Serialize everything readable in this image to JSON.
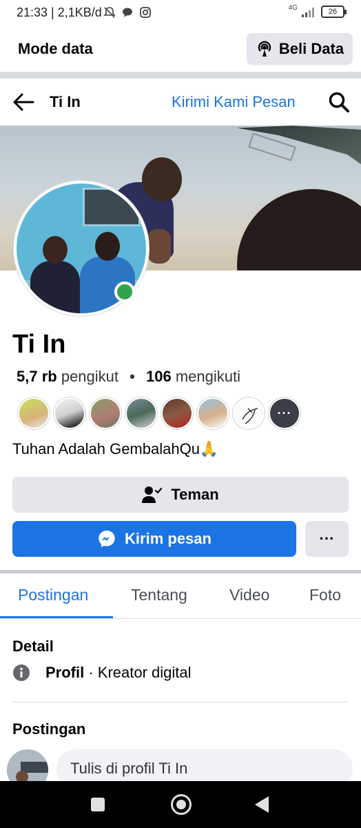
{
  "status_bar": {
    "time": "21:33",
    "network_speed": "2,1KB/d",
    "network_type": "4G",
    "battery": "26",
    "icons": [
      "bell-off-icon",
      "chat-bubble-icon",
      "instagram-icon",
      "signal-icon",
      "battery-icon"
    ]
  },
  "data_mode": {
    "title": "Mode data",
    "buy_button": "Beli Data",
    "buy_icon": "broadcast-icon"
  },
  "nav": {
    "title": "Ti In",
    "message_link": "Kirimi Kami Pesan",
    "icons": [
      "back-arrow-icon",
      "search-icon"
    ]
  },
  "profile": {
    "name": "Ti In",
    "followers_count": "5,7 rb",
    "followers_label": "pengikut",
    "following_count": "106",
    "following_label": "mengikuti",
    "separator": "•",
    "bio": "Tuhan Adalah GembalahQu🙏",
    "online": true,
    "friend_avatars_count": 8,
    "friend_more_label": "···"
  },
  "actions": {
    "friend_button": "Teman",
    "message_button": "Kirim pesan",
    "more_button": "···",
    "accent_color": "#1b74e4"
  },
  "tabs": [
    {
      "label": "Postingan",
      "active": true
    },
    {
      "label": "Tentang",
      "active": false
    },
    {
      "label": "Video",
      "active": false
    },
    {
      "label": "Foto",
      "active": false
    }
  ],
  "details": {
    "heading": "Detail",
    "profile_label": "Profil",
    "profile_category": "· Kreator digital"
  },
  "posts": {
    "heading": "Postingan",
    "composer_placeholder": "Tulis di profil Ti In"
  }
}
